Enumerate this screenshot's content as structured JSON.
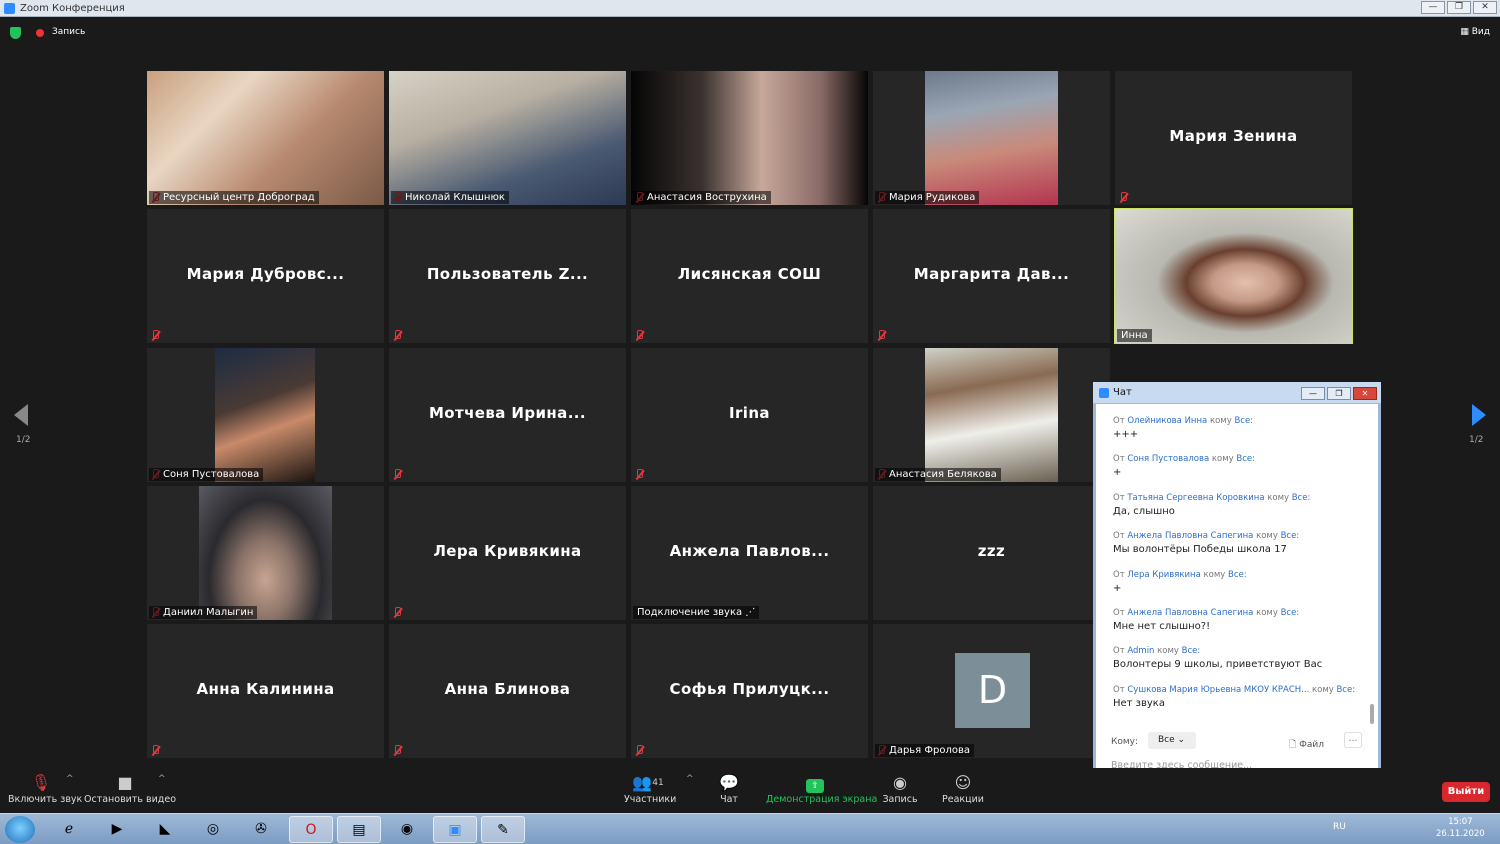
{
  "window": {
    "title": "Zoom Конференция"
  },
  "topbar": {
    "recording": "Запись",
    "view": "Вид"
  },
  "tiles": [
    {
      "name": "Ресурсный центр Доброград",
      "video": true
    },
    {
      "name": "Николай Клышнюк",
      "video": true
    },
    {
      "name": "Анастасия Вострухина",
      "video": true
    },
    {
      "name": "Мария Рудикова",
      "video": true
    },
    {
      "name": "Мария Зенина",
      "video": false
    },
    {
      "name": "Мария Дубровс...",
      "video": false
    },
    {
      "name": "Пользователь Z...",
      "video": false
    },
    {
      "name": "Лисянская СОШ",
      "video": false
    },
    {
      "name": "Маргарита Дав...",
      "video": false
    },
    {
      "name": "Инна",
      "video": true,
      "speaking": true
    },
    {
      "name": "Соня Пустовалова",
      "video": true
    },
    {
      "name": "Мотчева Ирина...",
      "video": false
    },
    {
      "name": "Irina",
      "video": false
    },
    {
      "name": "Анастасия Белякова",
      "video": true
    },
    {
      "name": "Даниил Малыгин",
      "video": true
    },
    {
      "name": "Лера Кривякина",
      "video": false
    },
    {
      "name": "Анжела Павлов...",
      "video": false,
      "status": "Подключение звука"
    },
    {
      "name": "zzz",
      "video": false
    },
    {
      "name": "Анна Калинина",
      "video": false
    },
    {
      "name": "Анна Блинова",
      "video": false
    },
    {
      "name": "Софья Прилуцк...",
      "video": false
    },
    {
      "name": "Дарья Фролова",
      "video": false,
      "avatar_letter": "D"
    }
  ],
  "pager": {
    "left": "1/2",
    "right": "1/2"
  },
  "chat": {
    "title": "Чат",
    "from_word": "От",
    "to_word": "кому",
    "all": "Все:",
    "messages": [
      {
        "from": "Олейникова Инна",
        "text": "+++"
      },
      {
        "from": "Соня Пустовалова",
        "text": "+"
      },
      {
        "from": "Татьяна Сергеевна Коровкина",
        "text": "Да, слышно"
      },
      {
        "from": "Анжела Павловна Сапегина",
        "text": "Мы волонтёры Победы школа 17"
      },
      {
        "from": "Лера Кривякина",
        "text": "+"
      },
      {
        "from": "Анжела Павловна Сапегина",
        "text": "Мне нет слышно?!"
      },
      {
        "from": "Admin",
        "text": "Волонтеры 9 школы, приветствуют Вас"
      },
      {
        "from": "Сушкова Мария Юрьевна МКОУ КРАСН...",
        "text": "Нет звука"
      }
    ],
    "to_label": "Кому:",
    "to_value": "Все",
    "file": "Файл",
    "placeholder": "Введите здесь сообщение..."
  },
  "toolbar": {
    "unmute": "Включить звук",
    "stop_video": "Остановить видео",
    "participants": "Участники",
    "participants_count": "41",
    "chat": "Чат",
    "share": "Демонстрация экрана",
    "record": "Запись",
    "reactions": "Реакции",
    "leave": "Выйти"
  },
  "taskbar": {
    "lang": "RU",
    "time": "15:07",
    "date": "26.11.2020"
  },
  "colors": {
    "accent": "#2d8cff",
    "green": "#23c25b",
    "leave": "#d8282d",
    "speaking": "#c9e36a"
  }
}
